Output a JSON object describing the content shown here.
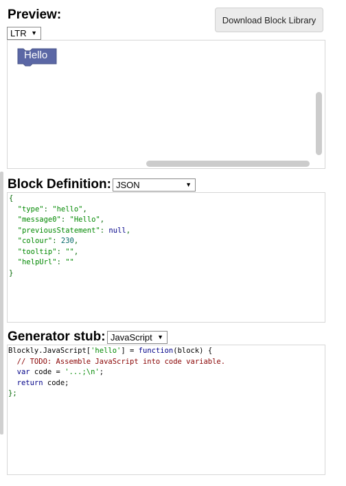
{
  "preview": {
    "title": "Preview:",
    "direction": "LTR",
    "download_button": "Download Block Library",
    "block_label": "Hello",
    "block_color": "#5b67a5"
  },
  "definition": {
    "title": "Block Definition:",
    "format": "JSON",
    "code": {
      "open": "{",
      "type_key": "\"type\"",
      "type_val": "\"hello\"",
      "message_key": "\"message0\"",
      "message_val": "\"Hello\"",
      "prev_key": "\"previousStatement\"",
      "prev_val": "null",
      "colour_key": "\"colour\"",
      "colour_val": "230",
      "tooltip_key": "\"tooltip\"",
      "tooltip_val": "\"\"",
      "help_key": "\"helpUrl\"",
      "help_val": "\"\"",
      "close": "}"
    }
  },
  "generator": {
    "title": "Generator stub:",
    "language": "JavaScript",
    "code": {
      "l1_a": "Blockly.JavaScript[",
      "l1_b": "'hello'",
      "l1_c": "] = ",
      "l1_d": "function",
      "l1_e": "(block) {",
      "l2": "  // TODO: Assemble JavaScript into code variable.",
      "l3_a": "  var",
      "l3_b": " code = ",
      "l3_c": "'...;\\n'",
      "l3_d": ";",
      "l4_a": "  return",
      "l4_b": " code;",
      "l5": "};"
    }
  }
}
